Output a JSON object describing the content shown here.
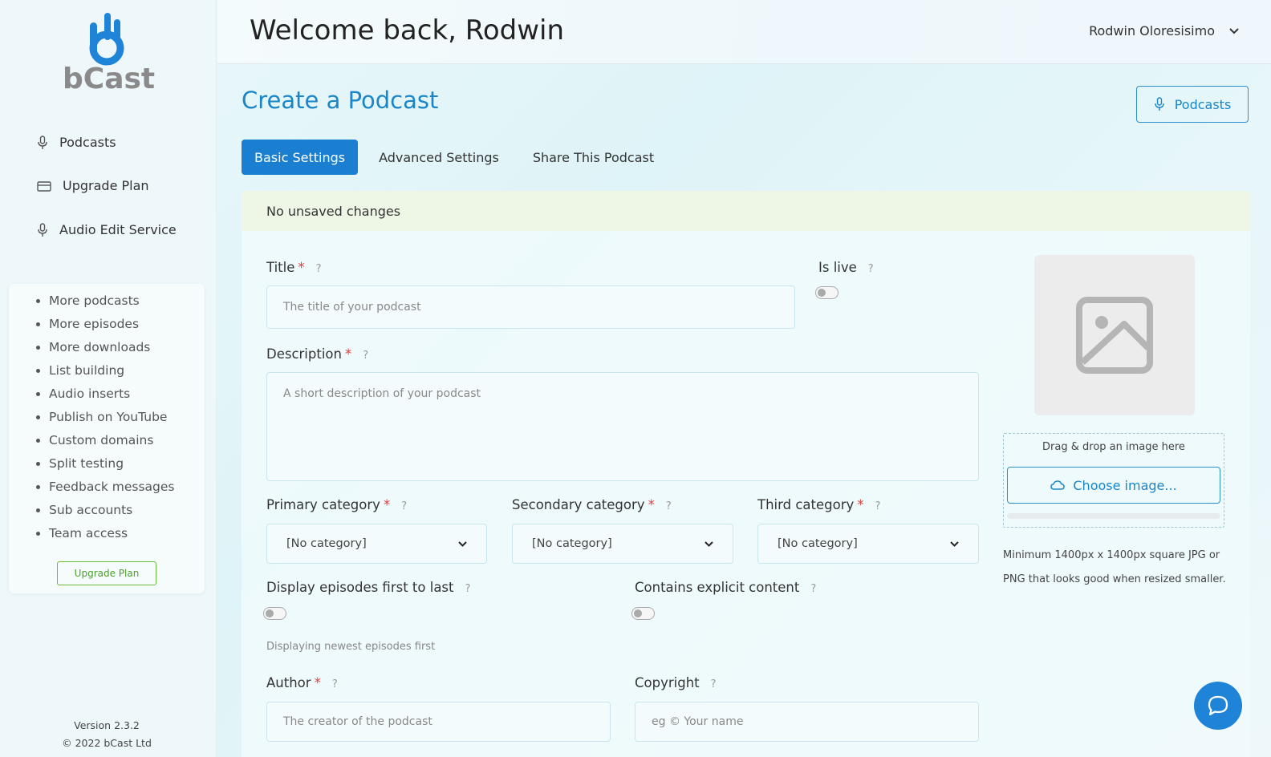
{
  "sidebar": {
    "brand": "bCast",
    "nav": [
      {
        "label": "Podcasts",
        "icon": "microphone-icon"
      },
      {
        "label": "Upgrade Plan",
        "icon": "credit-card-icon"
      },
      {
        "label": "Audio Edit Service",
        "icon": "microphone-icon"
      }
    ],
    "upgrade_features": [
      "More podcasts",
      "More episodes",
      "More downloads",
      "List building",
      "Audio inserts",
      "Publish on YouTube",
      "Custom domains",
      "Split testing",
      "Feedback messages",
      "Sub accounts",
      "Team access"
    ],
    "upgrade_button": "Upgrade Plan",
    "version": "Version 2.3.2",
    "copyright": "©  2022  bCast Ltd"
  },
  "header": {
    "welcome": "Welcome back, Rodwin",
    "user_name": "Rodwin Oloresisimo"
  },
  "main": {
    "title": "Create a Podcast",
    "podcasts_button": "Podcasts",
    "tabs": [
      {
        "label": "Basic Settings",
        "active": true
      },
      {
        "label": "Advanced Settings",
        "active": false
      },
      {
        "label": "Share This Podcast",
        "active": false
      }
    ],
    "status": "No unsaved changes",
    "form": {
      "title_label": "Title",
      "title_placeholder": "The title of your podcast",
      "is_live_label": "Is live",
      "is_live": false,
      "description_label": "Description",
      "description_placeholder": "A short description of your podcast",
      "primary_category_label": "Primary category",
      "secondary_category_label": "Secondary category",
      "third_category_label": "Third category",
      "primary_category_value": "[No category]",
      "secondary_category_value": "[No category]",
      "third_category_value": "[No category]",
      "display_order_label": "Display episodes first to last",
      "display_order": false,
      "display_order_hint": "Displaying newest episodes first",
      "explicit_label": "Contains explicit content",
      "explicit": false,
      "author_label": "Author",
      "author_placeholder": "The creator of the podcast",
      "copyright_label": "Copyright",
      "copyright_placeholder": "eg © Your name",
      "required_mark": "*",
      "help_mark": "?"
    },
    "image": {
      "drop_text": "Drag & drop an image here",
      "choose_button": "Choose image...",
      "note": "Minimum 1400px x 1400px square JPG or PNG that looks good when resized smaller."
    }
  },
  "colors": {
    "accent": "#1a7fd1",
    "brand_blue": "#1f84d8",
    "upgrade_green": "#4ca02a",
    "required_red": "#e23b3b"
  }
}
